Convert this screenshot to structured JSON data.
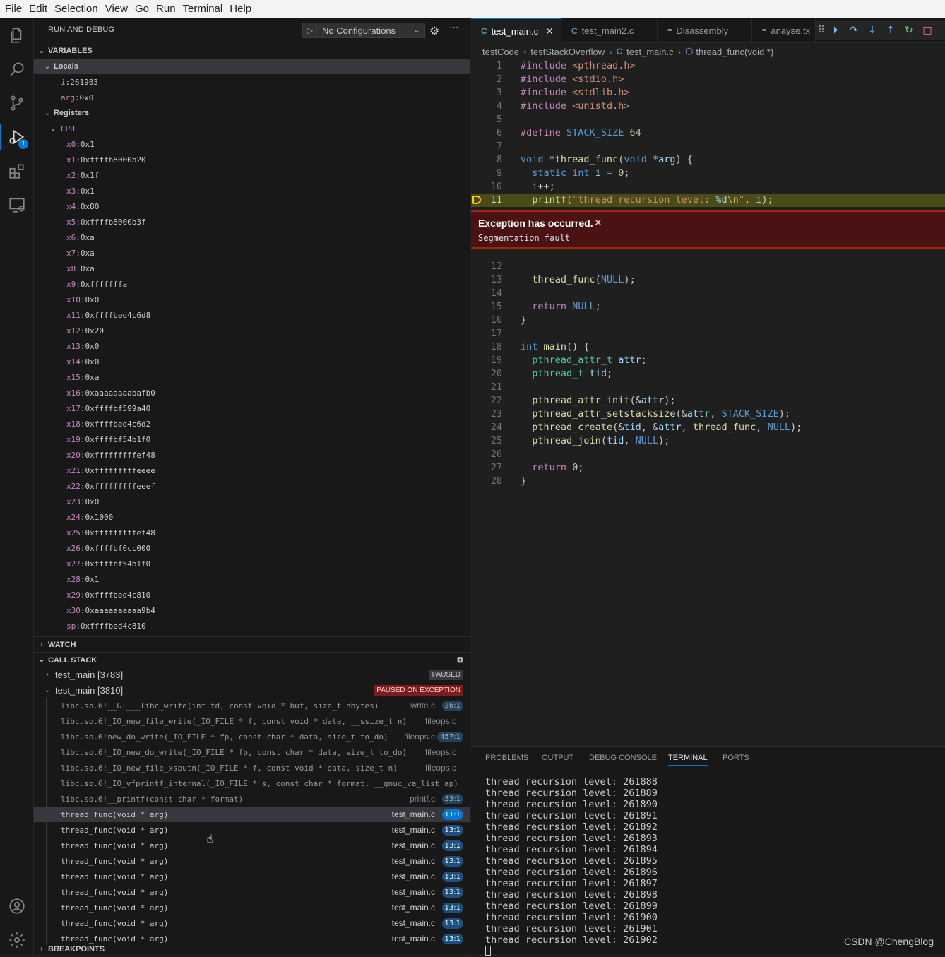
{
  "menu": [
    "File",
    "Edit",
    "Selection",
    "View",
    "Go",
    "Run",
    "Terminal",
    "Help"
  ],
  "activity": {
    "debug_badge": "1"
  },
  "sidebar": {
    "title": "RUN AND DEBUG",
    "config": "No Configurations",
    "variables_title": "VARIABLES",
    "locals_label": "Locals",
    "locals": [
      {
        "name": "i",
        "value": "261903"
      },
      {
        "name": "arg",
        "value": "0x0"
      }
    ],
    "registers_label": "Registers",
    "cpu_label": "CPU",
    "registers": [
      {
        "name": "x0",
        "value": "0x1"
      },
      {
        "name": "x1",
        "value": "0xffffb8000b20"
      },
      {
        "name": "x2",
        "value": "0x1f"
      },
      {
        "name": "x3",
        "value": "0x1"
      },
      {
        "name": "x4",
        "value": "0x80"
      },
      {
        "name": "x5",
        "value": "0xffffb8000b3f"
      },
      {
        "name": "x6",
        "value": "0xa"
      },
      {
        "name": "x7",
        "value": "0xa"
      },
      {
        "name": "x8",
        "value": "0xa"
      },
      {
        "name": "x9",
        "value": "0xfffffffa"
      },
      {
        "name": "x10",
        "value": "0x0"
      },
      {
        "name": "x11",
        "value": "0xffffbed4c6d8"
      },
      {
        "name": "x12",
        "value": "0x20"
      },
      {
        "name": "x13",
        "value": "0x0"
      },
      {
        "name": "x14",
        "value": "0x0"
      },
      {
        "name": "x15",
        "value": "0xa"
      },
      {
        "name": "x16",
        "value": "0xaaaaaaaabafb0"
      },
      {
        "name": "x17",
        "value": "0xffffbf599a40"
      },
      {
        "name": "x18",
        "value": "0xffffbed4c6d2"
      },
      {
        "name": "x19",
        "value": "0xffffbf54b1f0"
      },
      {
        "name": "x20",
        "value": "0xfffffffffef48"
      },
      {
        "name": "x21",
        "value": "0xfffffffffeeee"
      },
      {
        "name": "x22",
        "value": "0xfffffffffeeef"
      },
      {
        "name": "x23",
        "value": "0x0"
      },
      {
        "name": "x24",
        "value": "0x1000"
      },
      {
        "name": "x25",
        "value": "0xfffffffffef48"
      },
      {
        "name": "x26",
        "value": "0xffffbf6cc000"
      },
      {
        "name": "x27",
        "value": "0xffffbf54b1f0"
      },
      {
        "name": "x28",
        "value": "0x1"
      },
      {
        "name": "x29",
        "value": "0xffffbed4c810"
      },
      {
        "name": "x30",
        "value": "0xaaaaaaaaaa9b4"
      },
      {
        "name": "sp",
        "value": "0xffffbed4c810"
      }
    ],
    "watch_title": "WATCH",
    "callstack_title": "CALL STACK",
    "threads": [
      {
        "name": "test_main [3783]",
        "status": "PAUSED"
      },
      {
        "name": "test_main [3810]",
        "status": "PAUSED ON EXCEPTION"
      }
    ],
    "frames": [
      {
        "fn": "libc.so.6!__GI___libc_write(int fd, const void * buf, size_t nbytes)",
        "file": "write.c",
        "pos": "26:1",
        "dim": true
      },
      {
        "fn": "libc.so.6!_IO_new_file_write(_IO_FILE * f, const void * data, __ssize_t n)",
        "file": "fileops.c",
        "pos": "",
        "dim": true
      },
      {
        "fn": "libc.so.6!new_do_write(_IO_FILE * fp, const char * data, size_t to_do)",
        "file": "fileops.c",
        "pos": "457:1",
        "dim": true
      },
      {
        "fn": "libc.so.6!_IO_new_do_write(_IO_FILE * fp, const char * data, size_t to_do)",
        "file": "fileops.c",
        "pos": "",
        "dim": true
      },
      {
        "fn": "libc.so.6!_IO_new_file_xsputn(_IO_FILE * f, const void * data, size_t n)",
        "file": "fileops.c",
        "pos": "",
        "dim": true
      },
      {
        "fn": "libc.so.6!_IO_vfprintf_internal(_IO_FILE * s, const char * format, __gnuc_va_list ap)",
        "file": "",
        "pos": "",
        "dim": true
      },
      {
        "fn": "libc.so.6!__printf(const char * format)",
        "file": "printf.c",
        "pos": "33:1",
        "dim": true
      },
      {
        "fn": "thread_func(void * arg)",
        "file": "test_main.c",
        "pos": "11:1",
        "dim": false,
        "selected": true
      },
      {
        "fn": "thread_func(void * arg)",
        "file": "test_main.c",
        "pos": "13:1",
        "dim": false
      },
      {
        "fn": "thread_func(void * arg)",
        "file": "test_main.c",
        "pos": "13:1",
        "dim": false
      },
      {
        "fn": "thread_func(void * arg)",
        "file": "test_main.c",
        "pos": "13:1",
        "dim": false
      },
      {
        "fn": "thread_func(void * arg)",
        "file": "test_main.c",
        "pos": "13:1",
        "dim": false
      },
      {
        "fn": "thread_func(void * arg)",
        "file": "test_main.c",
        "pos": "13:1",
        "dim": false
      },
      {
        "fn": "thread_func(void * arg)",
        "file": "test_main.c",
        "pos": "13:1",
        "dim": false
      },
      {
        "fn": "thread_func(void * arg)",
        "file": "test_main.c",
        "pos": "13:1",
        "dim": false
      },
      {
        "fn": "thread_func(void * arg)",
        "file": "test_main.c",
        "pos": "13:1",
        "dim": false
      }
    ],
    "breakpoints_title": "BREAKPOINTS"
  },
  "tabs": [
    {
      "label": "test_main.c",
      "icon": "C",
      "active": true
    },
    {
      "label": "test_main2.c",
      "icon": "C",
      "active": false
    },
    {
      "label": "Disassembly",
      "icon": "≡",
      "active": false
    },
    {
      "label": "anayse.tx",
      "icon": "≡",
      "active": false
    }
  ],
  "breadcrumb": [
    "testCode",
    "testStackOverflow",
    "test_main.c",
    "thread_func(void *)"
  ],
  "exception": {
    "title": "Exception has occurred.",
    "message": "Segmentation fault"
  },
  "panel": {
    "tabs": [
      "PROBLEMS",
      "OUTPUT",
      "DEBUG CONSOLE",
      "TERMINAL",
      "PORTS"
    ],
    "active": "TERMINAL",
    "terminal_lines": [
      "thread recursion level: 261888",
      "thread recursion level: 261889",
      "thread recursion level: 261890",
      "thread recursion level: 261891",
      "thread recursion level: 261892",
      "thread recursion level: 261893",
      "thread recursion level: 261894",
      "thread recursion level: 261895",
      "thread recursion level: 261896",
      "thread recursion level: 261897",
      "thread recursion level: 261898",
      "thread recursion level: 261899",
      "thread recursion level: 261900",
      "thread recursion level: 261901",
      "thread recursion level: 261902"
    ]
  },
  "watermark": "CSDN @ChengBlog"
}
